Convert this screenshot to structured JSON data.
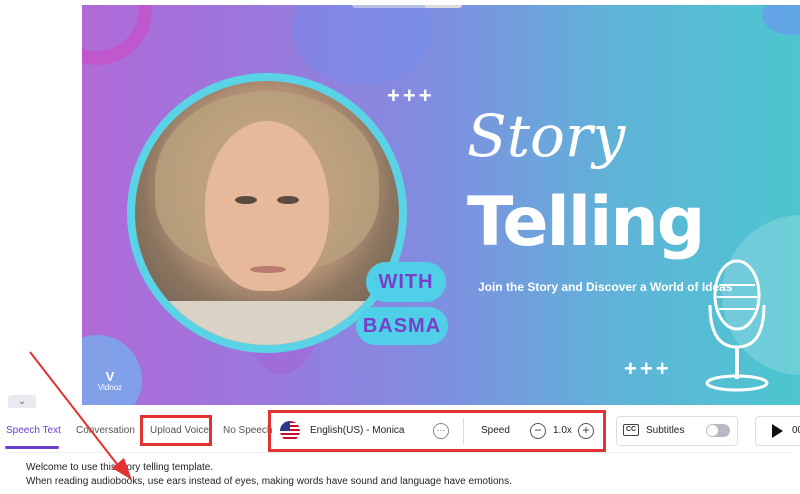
{
  "slide": {
    "title_script": "Story",
    "title_bold": "Telling",
    "tagline": "Join the Story and Discover a World of Ideas",
    "with_label": "WITH",
    "name_label": "BASMA",
    "plus_marks": "+++",
    "brand_mark": "V",
    "brand_name": "Vidnoz"
  },
  "tabs": [
    {
      "label": "Speech Text",
      "active": true
    },
    {
      "label": "Conversation",
      "active": false
    },
    {
      "label": "Upload Voice",
      "active": false
    },
    {
      "label": "No Speech",
      "active": false
    }
  ],
  "voice": {
    "selected": "English(US) - Monica",
    "more_label": "···"
  },
  "speed": {
    "label": "Speed",
    "value": "1.0x",
    "minus": "−",
    "plus": "+"
  },
  "subtitles": {
    "icon_label": "CC",
    "label": "Subtitles",
    "enabled": false
  },
  "playback": {
    "time": "00"
  },
  "speech_text": {
    "line1": "Welcome to use this story telling template.",
    "line2": "When reading audiobooks, use ears instead of eyes, making words have sound and language have emotions."
  },
  "colors": {
    "accent": "#6d3fcf",
    "annotation": "#e23232"
  }
}
